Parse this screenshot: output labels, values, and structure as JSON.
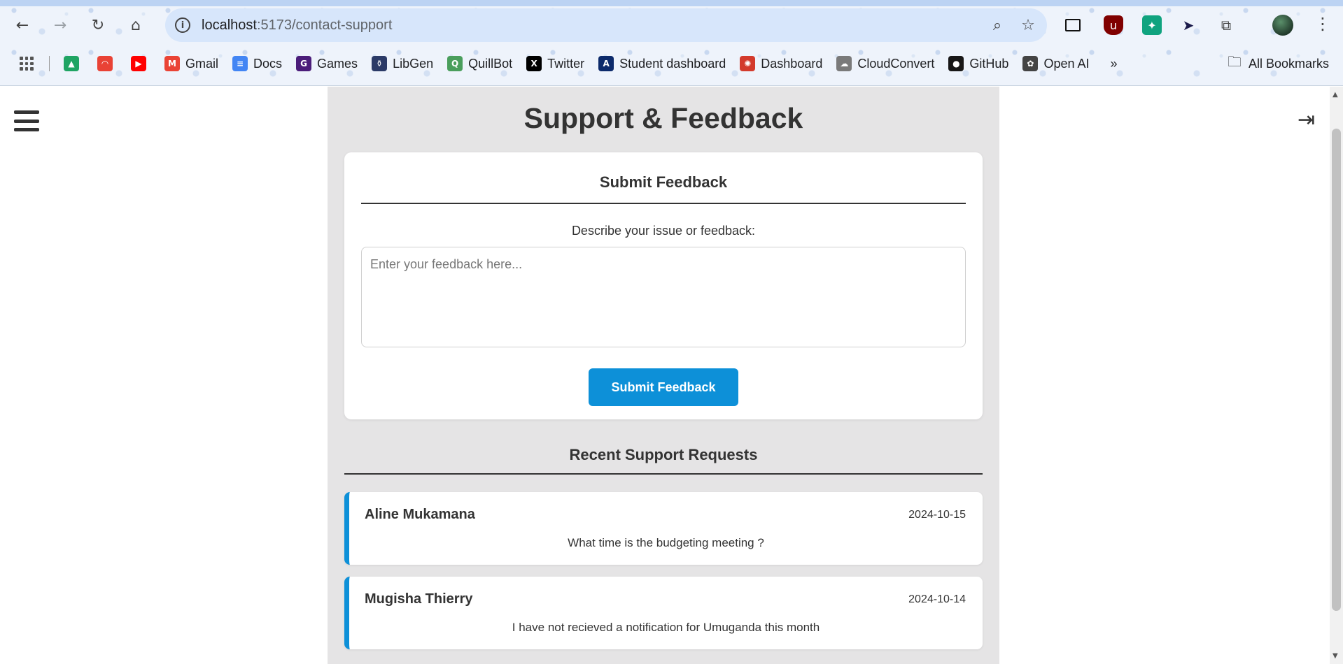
{
  "browser": {
    "url_host": "localhost",
    "url_path": ":5173/contact-support",
    "bookmarks": [
      {
        "label": "",
        "icon": "google-drive-icon",
        "color": "#1fa463"
      },
      {
        "label": "",
        "icon": "rainbow-icon",
        "color": "#e94235"
      },
      {
        "label": "",
        "icon": "youtube-icon",
        "color": "#ff0000"
      },
      {
        "label": "Gmail",
        "icon": "gmail-icon",
        "color": "#ea4335"
      },
      {
        "label": "Docs",
        "icon": "docs-icon",
        "color": "#4285f4"
      },
      {
        "label": "Games",
        "icon": "games-icon",
        "color": "#4b1d7a"
      },
      {
        "label": "LibGen",
        "icon": "libgen-icon",
        "color": "#2b3a67"
      },
      {
        "label": "QuillBot",
        "icon": "quillbot-icon",
        "color": "#4a9e5c"
      },
      {
        "label": "Twitter",
        "icon": "x-icon",
        "color": "#000000"
      },
      {
        "label": "Student dashboard",
        "icon": "student-dashboard-icon",
        "color": "#0c2a6b"
      },
      {
        "label": "Dashboard",
        "icon": "canvas-icon",
        "color": "#d33a2c"
      },
      {
        "label": "CloudConvert",
        "icon": "cloudconvert-icon",
        "color": "#7a7a7a"
      },
      {
        "label": "GitHub",
        "icon": "github-icon",
        "color": "#181717"
      },
      {
        "label": "Open AI",
        "icon": "openai-icon",
        "color": "#444444"
      }
    ],
    "more_bookmarks": "»",
    "all_bookmarks": "All Bookmarks"
  },
  "page": {
    "title": "Support & Feedback",
    "form": {
      "title": "Submit Feedback",
      "label": "Describe your issue or feedback:",
      "placeholder": "Enter your feedback here...",
      "value": "",
      "submit_label": "Submit Feedback"
    },
    "recent": {
      "title": "Recent Support Requests",
      "requests": [
        {
          "name": "Aline Mukamana",
          "date": "2024-10-15",
          "message": "What time is the budgeting meeting ?"
        },
        {
          "name": "Mugisha Thierry",
          "date": "2024-10-14",
          "message": "I have not recieved a notification for Umuganda this month"
        }
      ]
    }
  },
  "colors": {
    "accent": "#0d90d8",
    "panel_bg": "#e5e4e5"
  }
}
